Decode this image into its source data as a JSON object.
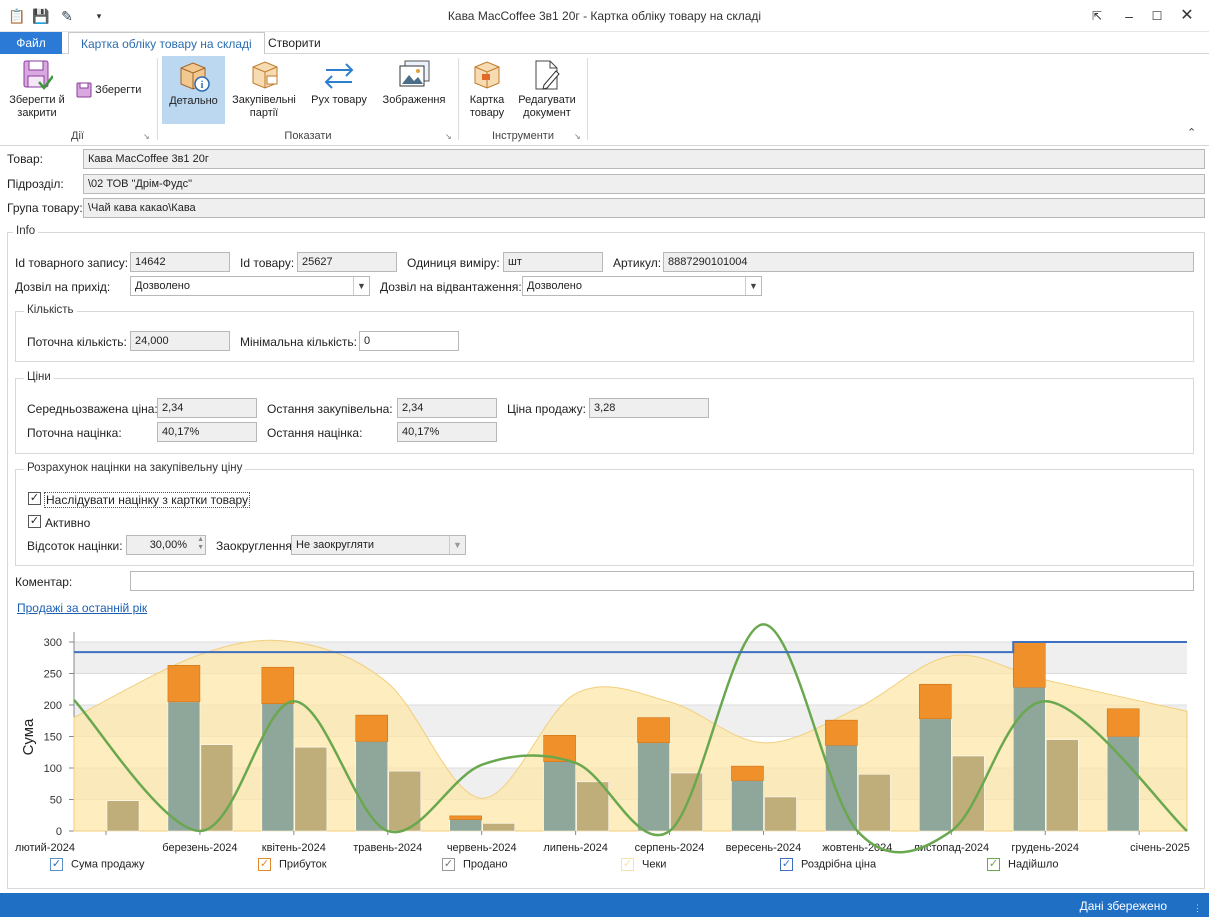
{
  "window": {
    "title": "Кава MacCoffee 3в1 20г - Картка обліку товару на складі",
    "quick_access": [
      "clipboard-icon",
      "save-icon",
      "edit-doc-icon",
      "dropdown-icon"
    ]
  },
  "menu": {
    "file": "Файл",
    "tabs": [
      "Картка обліку товару на складі",
      "Створити"
    ]
  },
  "ribbon": {
    "groups": {
      "actions": "Дії",
      "show": "Показати",
      "tools": "Інструменти"
    },
    "buttons": {
      "save_close": "Зберегти й закрити",
      "save": "Зберегти",
      "details": "Детально",
      "purchase_batches": "Закупівельні партії",
      "movement": "Рух товару",
      "images": "Зображення",
      "product_card": "Картка товару",
      "edit_document": "Редагувати документ"
    }
  },
  "top_fields": {
    "product_label": "Товар:",
    "product_value": "Кава MacCoffee 3в1 20г",
    "division_label": "Підрозділ:",
    "division_value": "\\02 ТОВ \"Дрім-Фудс\"",
    "group_label": "Група товару:",
    "group_value": "\\Чай кава какао\\Кава"
  },
  "info": {
    "title": "Info",
    "record_id_label": "Id товарного запису:",
    "record_id": "14642",
    "product_id_label": "Id товару:",
    "product_id": "25627",
    "unit_label": "Одиниця виміру:",
    "unit": "шт",
    "article_label": "Артикул:",
    "article": "8887290101004",
    "incoming_label": "Дозвіл на прихід:",
    "incoming": "Дозволено",
    "shipment_label": "Дозвіл на відвантаження:",
    "shipment": "Дозволено"
  },
  "quantity": {
    "title": "Кількість",
    "current_label": "Поточна кількість:",
    "current": "24,000",
    "min_label": "Мінімальна кількість:",
    "min": "0"
  },
  "prices": {
    "title": "Ціни",
    "weighted_label": "Середньозважена ціна:",
    "weighted": "2,34",
    "last_purchase_label": "Остання закупівельна:",
    "last_purchase": "2,34",
    "sale_label": "Ціна продажу:",
    "sale": "3,28",
    "current_markup_label": "Поточна націнка:",
    "current_markup": "40,17%",
    "last_markup_label": "Остання націнка:",
    "last_markup": "40,17%"
  },
  "markup_calc": {
    "title": "Розрахунок націнки на закупівельну ціну",
    "inherit_label": "Наслідувати націнку з картки товару",
    "inherit_checked": true,
    "active_label": "Активно",
    "active_checked": true,
    "percent_label": "Відсоток націнки:",
    "percent": "30,00%",
    "rounding_label": "Заокруглення:",
    "rounding": "Не заокругляти"
  },
  "comment": {
    "label": "Коментар:",
    "value": ""
  },
  "sales_link": "Продажі за останній рік",
  "chart_data": {
    "type": "bar",
    "ylabel": "Сума",
    "xlabel": "",
    "ylim": [
      0,
      300
    ],
    "yticks": [
      0,
      50,
      100,
      150,
      200,
      250,
      300
    ],
    "grid": true,
    "legend_position": "bottom",
    "categories": [
      "лютий-2024",
      "березень-2024",
      "квітень-2024",
      "травень-2024",
      "червень-2024",
      "липень-2024",
      "серпень-2024",
      "вересень-2024",
      "жовтень-2024",
      "листопад-2024",
      "грудень-2024",
      "січень-2025"
    ],
    "series": [
      {
        "name": "Сума продажу",
        "kind": "stacked-bar",
        "color": "#8fa69a",
        "values": [
          0,
          205,
          202,
          142,
          18,
          110,
          140,
          80,
          136,
          178,
          228,
          150
        ]
      },
      {
        "name": "Прибуток",
        "kind": "stacked-bar",
        "color": "#f0902a",
        "values": [
          0,
          58,
          58,
          42,
          6,
          42,
          40,
          23,
          40,
          55,
          72,
          44
        ]
      },
      {
        "name": "Продано",
        "kind": "bar",
        "color": "#bfae7a",
        "values": [
          48,
          137,
          133,
          95,
          12,
          78,
          92,
          54,
          90,
          119,
          145,
          0
        ]
      },
      {
        "name": "Чеки",
        "kind": "area",
        "color": "#fde7a8",
        "values": [
          180,
          280,
          300,
          235,
          52,
          218,
          205,
          140,
          195,
          278,
          240,
          190
        ]
      },
      {
        "name": "Роздрібна ціна",
        "kind": "step-line",
        "color": "#3e6fc0",
        "values": [
          284,
          284,
          284,
          284,
          284,
          284,
          284,
          284,
          284,
          284,
          300,
          300
        ]
      },
      {
        "name": "Надійшло",
        "kind": "smooth-line",
        "color": "#6aa84f",
        "values": [
          208,
          0,
          206,
          0,
          105,
          108,
          0,
          328,
          0,
          0,
          206,
          0
        ]
      }
    ]
  },
  "status": "Дані збережено",
  "colors": {
    "accent": "#2b7ad6",
    "statusbar": "#1f6fc5"
  }
}
